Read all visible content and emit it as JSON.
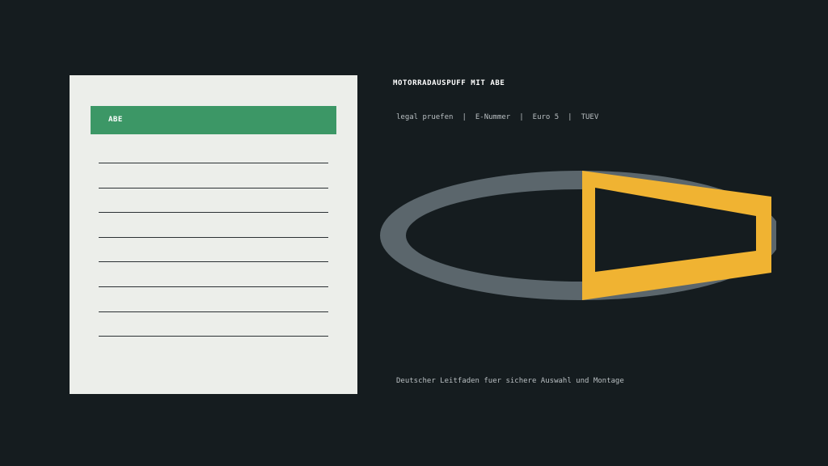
{
  "document_card": {
    "header_label": "ABE",
    "header_color": "#3c9766",
    "line_count": 8
  },
  "title": "MOTORRADAUSPUFF MIT ABE",
  "tags": [
    "legal pruefen",
    "E-Nummer",
    "Euro 5",
    "TUEV"
  ],
  "tag_separator": "|",
  "footer": "Deutscher Leitfaden fuer sichere Auswahl und Montage",
  "illustration": {
    "ring_icon": "exhaust-ring-icon",
    "muffler_icon": "muffler-outline-icon",
    "ring_color": "#5b666c",
    "accent_color": "#f0b332"
  }
}
